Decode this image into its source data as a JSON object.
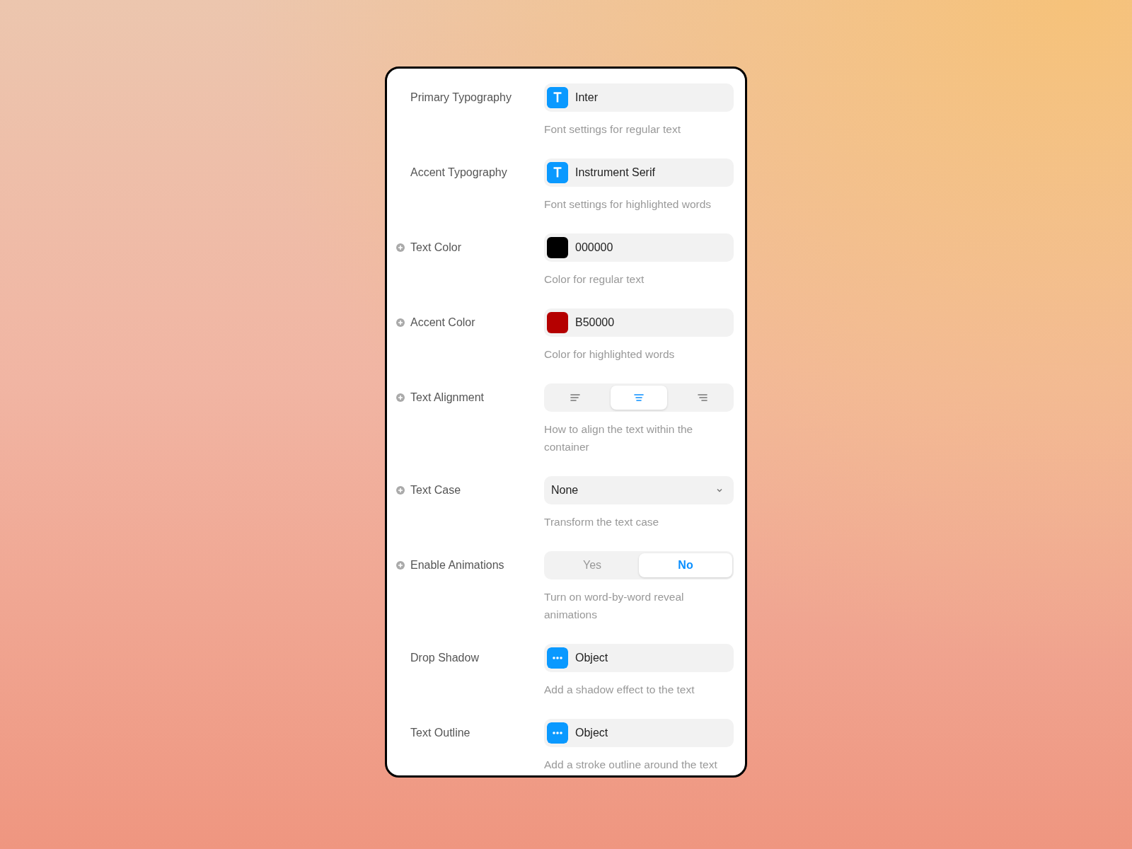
{
  "settings": [
    {
      "kind": "font",
      "label": "Primary Typography",
      "addable": false,
      "value": "Inter",
      "description": "Font settings for regular text"
    },
    {
      "kind": "font",
      "label": "Accent Typography",
      "addable": false,
      "value": "Instrument Serif",
      "description": "Font settings for highlighted words"
    },
    {
      "kind": "color",
      "label": "Text Color",
      "addable": true,
      "color": "#000000",
      "value": "000000",
      "description": "Color for regular text"
    },
    {
      "kind": "color",
      "label": "Accent Color",
      "addable": true,
      "color": "#b50000",
      "value": "B50000",
      "description": "Color for highlighted words"
    },
    {
      "kind": "align",
      "label": "Text Alignment",
      "addable": true,
      "options": [
        {
          "kind": "left",
          "selected": false
        },
        {
          "kind": "center",
          "selected": true
        },
        {
          "kind": "right",
          "selected": false
        }
      ],
      "description": "How to align the text within the container"
    },
    {
      "kind": "dropdown",
      "label": "Text Case",
      "addable": true,
      "value": "None",
      "description": "Transform the text case"
    },
    {
      "kind": "toggle",
      "label": "Enable Animations",
      "addable": true,
      "options": [
        {
          "label": "Yes",
          "selected": false
        },
        {
          "label": "No",
          "selected": true
        }
      ],
      "description": "Turn on word-by-word reveal animations"
    },
    {
      "kind": "object",
      "label": "Drop Shadow",
      "addable": false,
      "value": "Object",
      "description": "Add a shadow effect to the text"
    },
    {
      "kind": "object",
      "label": "Text Outline",
      "addable": false,
      "value": "Object",
      "description": "Add a stroke outline around the text"
    }
  ]
}
